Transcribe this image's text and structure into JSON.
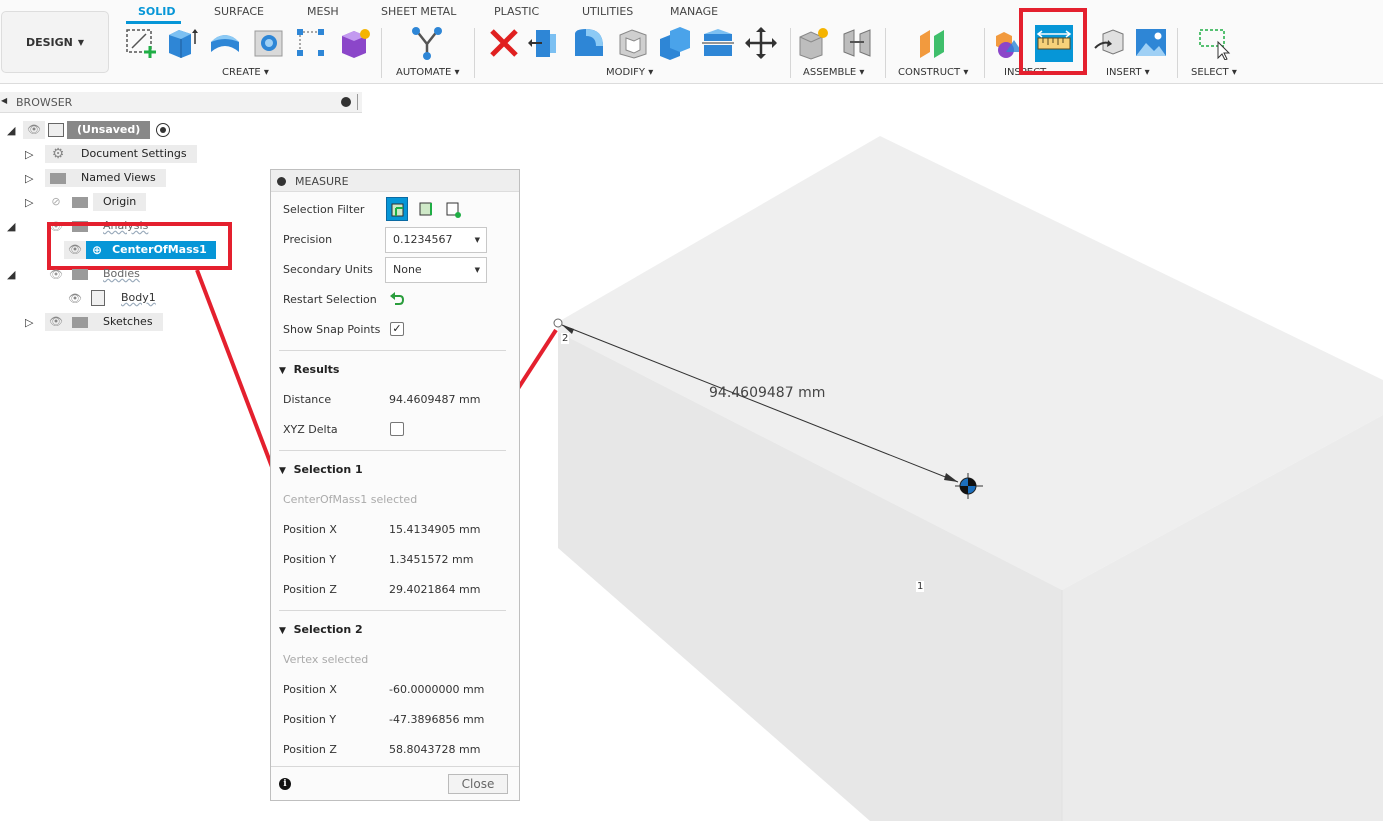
{
  "toolbar": {
    "design_label": "DESIGN",
    "tabs": [
      {
        "label": "SOLID"
      },
      {
        "label": "SURFACE"
      },
      {
        "label": "MESH"
      },
      {
        "label": "SHEET METAL"
      },
      {
        "label": "PLASTIC"
      },
      {
        "label": "UTILITIES"
      },
      {
        "label": "MANAGE"
      }
    ],
    "groups": {
      "create": "CREATE",
      "automate": "AUTOMATE",
      "modify": "MODIFY",
      "assemble": "ASSEMBLE",
      "construct": "CONSTRUCT",
      "inspect": "INSPECT",
      "insert": "INSERT",
      "select": "SELECT"
    }
  },
  "browser": {
    "title": "BROWSER",
    "items": [
      {
        "label": "(Unsaved)"
      },
      {
        "label": "Document Settings"
      },
      {
        "label": "Named Views"
      },
      {
        "label": "Origin"
      },
      {
        "label": "Analysis"
      },
      {
        "label": "CenterOfMass1"
      },
      {
        "label": "Bodies"
      },
      {
        "label": "Body1"
      },
      {
        "label": "Sketches"
      }
    ]
  },
  "measure": {
    "title": "MEASURE",
    "selection_filter_label": "Selection Filter",
    "precision_label": "Precision",
    "precision_value": "0.1234567",
    "secondary_units_label": "Secondary Units",
    "secondary_units_value": "None",
    "restart_selection_label": "Restart Selection",
    "show_snap_points_label": "Show Snap Points",
    "show_snap_points_checked": true,
    "results": {
      "header": "Results",
      "distance_label": "Distance",
      "distance_value": "94.4609487 mm",
      "xyz_delta_label": "XYZ Delta",
      "xyz_delta_checked": false
    },
    "selection1": {
      "header": "Selection 1",
      "subtitle": "CenterOfMass1 selected",
      "pos_x_label": "Position X",
      "pos_x": "15.4134905 mm",
      "pos_y_label": "Position Y",
      "pos_y": "1.3451572 mm",
      "pos_z_label": "Position Z",
      "pos_z": "29.4021864 mm"
    },
    "selection2": {
      "header": "Selection 2",
      "subtitle": "Vertex selected",
      "pos_x_label": "Position X",
      "pos_x": "-60.0000000 mm",
      "pos_y_label": "Position Y",
      "pos_y": "-47.3896856 mm",
      "pos_z_label": "Position Z",
      "pos_z": "58.8043728 mm"
    },
    "close_label": "Close"
  },
  "viewport": {
    "distance_annotation": "94.4609487 mm",
    "point1_label": "1",
    "point2_label": "2"
  },
  "colors": {
    "accent": "#0696d7",
    "highlight": "#e4202e"
  }
}
